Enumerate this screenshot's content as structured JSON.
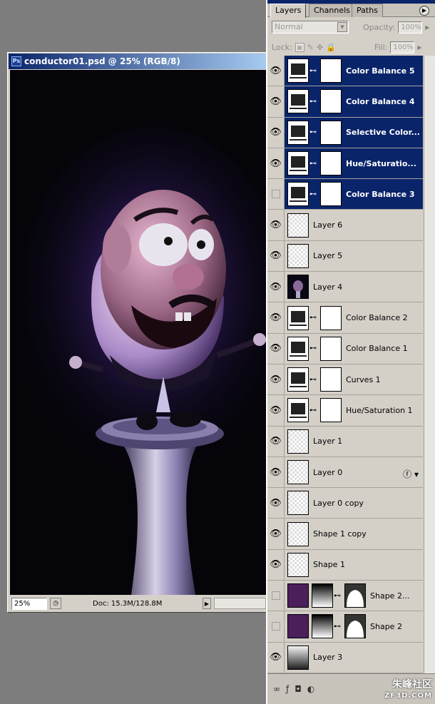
{
  "document": {
    "title": "conductor01.psd @ 25% (RGB/8)",
    "zoom": "25%",
    "doc_info": "Doc: 15.3M/128.8M"
  },
  "layers_panel": {
    "tabs": [
      "Layers",
      "Channels",
      "Paths"
    ],
    "blend_mode": "Normal",
    "opacity_label": "Opacity:",
    "opacity_value": "100%",
    "lock_label": "Lock:",
    "fill_label": "Fill:",
    "fill_value": "100%",
    "layers": [
      {
        "name": "Color Balance 5",
        "visible": true,
        "selected": true,
        "type": "adjust"
      },
      {
        "name": "Color Balance 4",
        "visible": true,
        "selected": true,
        "type": "adjust"
      },
      {
        "name": "Selective Color...",
        "visible": true,
        "selected": true,
        "type": "adjust"
      },
      {
        "name": "Hue/Saturatio...",
        "visible": true,
        "selected": true,
        "type": "adjust"
      },
      {
        "name": "Color Balance 3",
        "visible": false,
        "selected": true,
        "type": "adjust"
      },
      {
        "name": "Layer 6",
        "visible": true,
        "selected": false,
        "type": "pixel"
      },
      {
        "name": "Layer 5",
        "visible": true,
        "selected": false,
        "type": "pixel"
      },
      {
        "name": "Layer 4",
        "visible": true,
        "selected": false,
        "type": "image"
      },
      {
        "name": "Color Balance 2",
        "visible": true,
        "selected": false,
        "type": "adjust"
      },
      {
        "name": "Color Balance 1",
        "visible": true,
        "selected": false,
        "type": "adjust"
      },
      {
        "name": "Curves 1",
        "visible": true,
        "selected": false,
        "type": "adjust"
      },
      {
        "name": "Hue/Saturation 1",
        "visible": true,
        "selected": false,
        "type": "adjust"
      },
      {
        "name": "Layer 1",
        "visible": true,
        "selected": false,
        "type": "pixel"
      },
      {
        "name": "Layer 0",
        "visible": true,
        "selected": false,
        "type": "pixel"
      },
      {
        "name": "Layer 0 copy",
        "visible": true,
        "selected": false,
        "type": "pixel"
      },
      {
        "name": "Shape 1 copy",
        "visible": true,
        "selected": false,
        "type": "pixel"
      },
      {
        "name": "Shape 1",
        "visible": true,
        "selected": false,
        "type": "pixel"
      },
      {
        "name": "Shape 2...",
        "visible": false,
        "selected": false,
        "type": "shape"
      },
      {
        "name": "Shape 2",
        "visible": false,
        "selected": false,
        "type": "shape"
      },
      {
        "name": "Layer 3",
        "visible": true,
        "selected": false,
        "type": "gradient"
      }
    ]
  },
  "watermark": {
    "text": "朱峰社区",
    "sub": "ZF3D.COM"
  },
  "colors": {
    "selection": "#0a246a",
    "panel_bg": "#d4d0c8",
    "canvas_bg": "#050409"
  }
}
